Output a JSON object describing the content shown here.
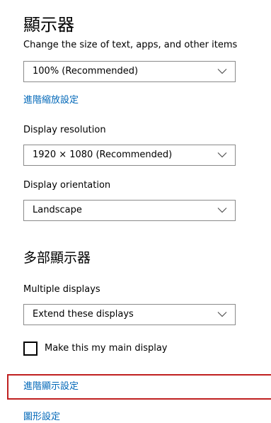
{
  "display_heading": "顯示器",
  "scale": {
    "label": "Change the size of text, apps, and other items",
    "selected": "100% (Recommended)"
  },
  "advanced_scaling_link": "進階縮放設定",
  "resolution": {
    "label": "Display resolution",
    "selected": "1920 × 1080 (Recommended)"
  },
  "orientation": {
    "label": "Display orientation",
    "selected": "Landscape"
  },
  "multiple_heading": "多部顯示器",
  "multiple": {
    "label": "Multiple displays",
    "selected": "Extend these displays"
  },
  "main_display_checkbox": {
    "label": "Make this my main display",
    "checked": false
  },
  "advanced_display_link": "進階顯示設定",
  "graphics_link": "圖形設定",
  "colors": {
    "link": "#0067b8",
    "highlight_border": "#c02020",
    "select_border": "#8a8a8a"
  },
  "icons": {
    "dropdown": "chevron-down-icon"
  }
}
